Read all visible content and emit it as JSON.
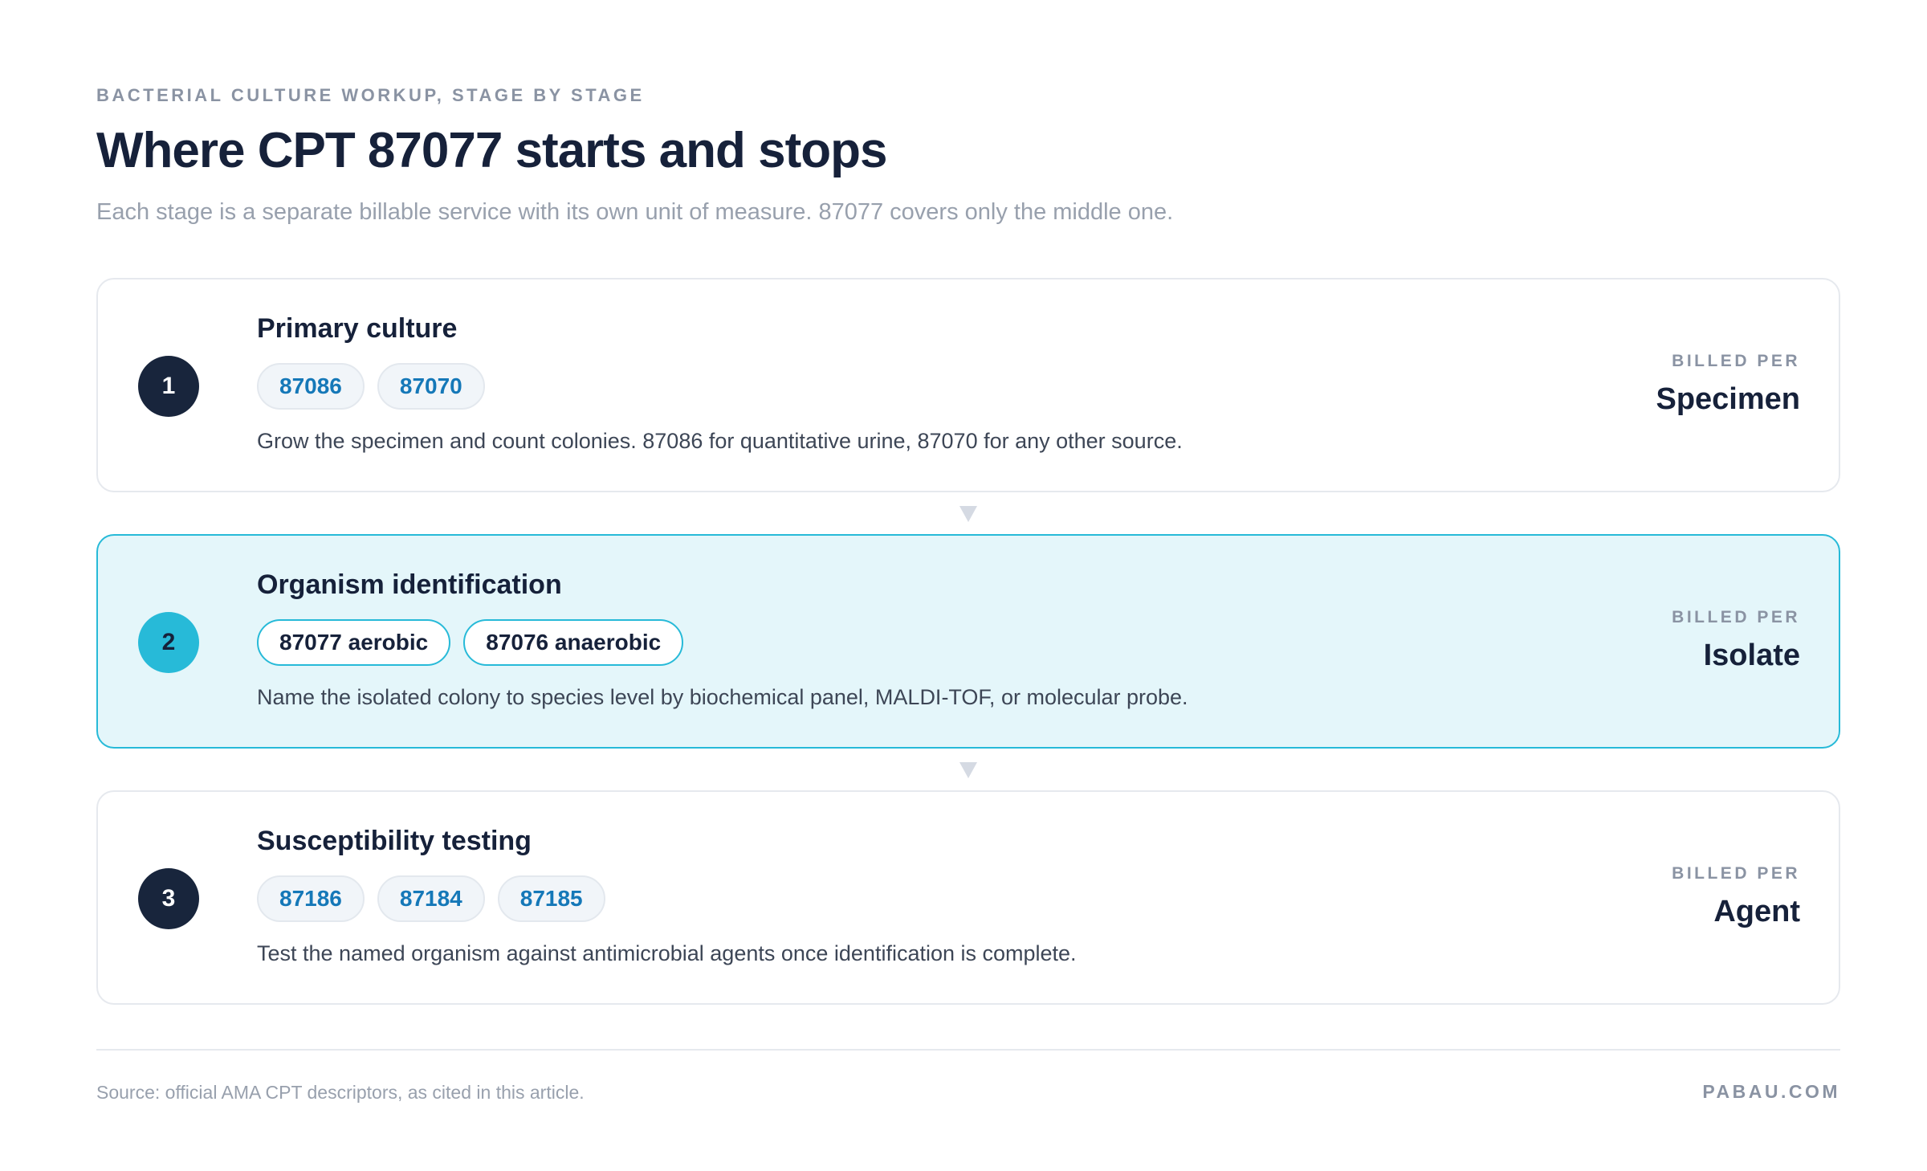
{
  "header": {
    "eyebrow": "BACTERIAL CULTURE WORKUP, STAGE BY STAGE",
    "title": "Where CPT 87077 starts and stops",
    "subtitle": "Each stage is a separate billable service with its own unit of measure. 87077 covers only the middle one."
  },
  "stages": [
    {
      "number": "1",
      "title": "Primary culture",
      "codes": [
        "87086",
        "87070"
      ],
      "description": "Grow the specimen and count colonies. 87086 for quantitative urine, 87070 for any other source.",
      "billed_label": "BILLED PER",
      "billed_unit": "Specimen",
      "highlighted": false
    },
    {
      "number": "2",
      "title": "Organism identification",
      "codes": [
        "87077 aerobic",
        "87076 anaerobic"
      ],
      "description": "Name the isolated colony to species level by biochemical panel, MALDI-TOF, or molecular probe.",
      "billed_label": "BILLED PER",
      "billed_unit": "Isolate",
      "highlighted": true
    },
    {
      "number": "3",
      "title": "Susceptibility testing",
      "codes": [
        "87186",
        "87184",
        "87185"
      ],
      "description": "Test the named organism against antimicrobial agents once identification is complete.",
      "billed_label": "BILLED PER",
      "billed_unit": "Agent",
      "highlighted": false
    }
  ],
  "footer": {
    "source": "Source: official AMA CPT descriptors, as cited in this article.",
    "brand": "PABAU.COM"
  },
  "colors": {
    "accent": "#27bad8",
    "accent_background": "#e4f6fa",
    "dark": "#16213a",
    "code_text": "#1578b8"
  }
}
